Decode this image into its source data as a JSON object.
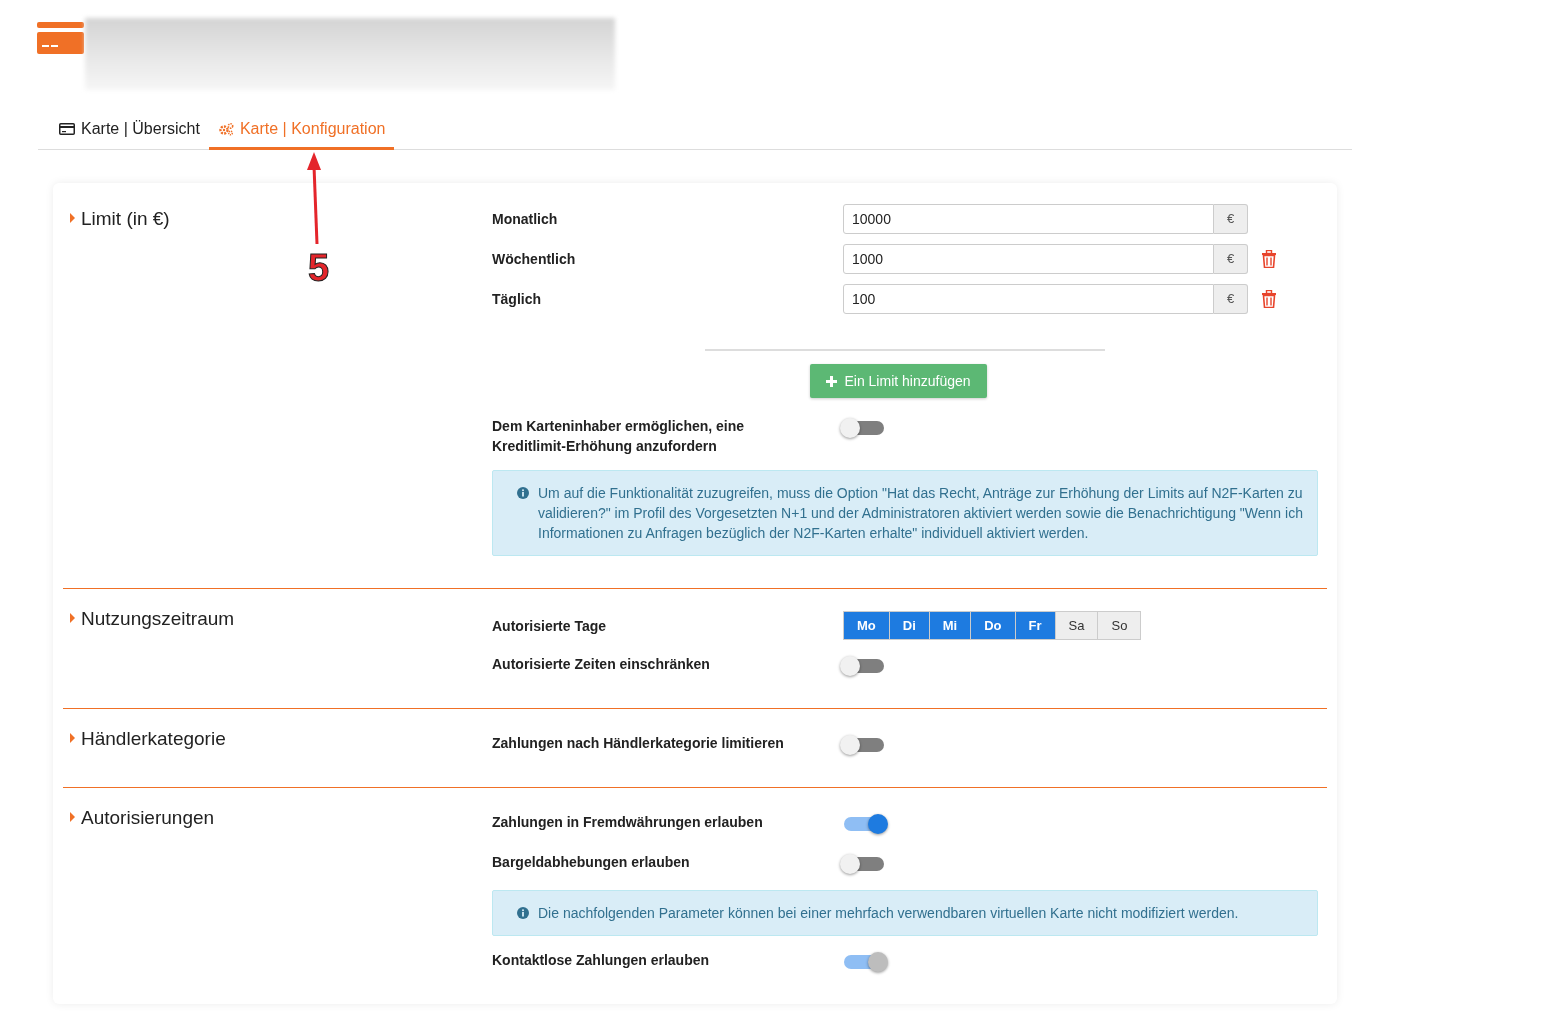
{
  "tabs": [
    {
      "label": "Karte | Übersicht",
      "selected": false
    },
    {
      "label": "Karte | Konfiguration",
      "selected": true
    }
  ],
  "annotation": {
    "label": "5"
  },
  "sections": [
    {
      "title": "Limit (in €)",
      "rows": [
        {
          "kind": "amount",
          "label": "Monatlich",
          "value": "10000",
          "unit": "€",
          "deletable": false
        },
        {
          "kind": "amount",
          "label": "Wöchentlich",
          "value": "1000",
          "unit": "€",
          "deletable": true
        },
        {
          "kind": "amount",
          "label": "Täglich",
          "value": "100",
          "unit": "€",
          "deletable": true
        },
        {
          "kind": "divider"
        },
        {
          "kind": "add_button",
          "label": "Ein Limit hinzufügen"
        },
        {
          "kind": "toggle",
          "label": "Dem Karteninhaber ermöglichen, eine Kreditlimit-Erhöhung anzufordern",
          "on": false,
          "disabled": false
        },
        {
          "kind": "info",
          "text": "Um auf die Funktionalität zuzugreifen, muss die Option \"Hat das Recht, Anträge zur Erhöhung der Limits auf N2F-Karten zu validieren?\" im Profil des Vorgesetzten N+1 und der Administratoren aktiviert werden sowie die Benachrichtigung \"Wenn ich Informationen zu Anfragen bezüglich der N2F-Karten erhalte\" individuell aktiviert werden."
        }
      ]
    },
    {
      "title": "Nutzungszeitraum",
      "rows": [
        {
          "kind": "days",
          "label": "Autorisierte Tage",
          "days": [
            {
              "label": "Mo",
              "selected": true
            },
            {
              "label": "Di",
              "selected": true
            },
            {
              "label": "Mi",
              "selected": true
            },
            {
              "label": "Do",
              "selected": true
            },
            {
              "label": "Fr",
              "selected": true
            },
            {
              "label": "Sa",
              "selected": false
            },
            {
              "label": "So",
              "selected": false
            }
          ]
        },
        {
          "kind": "toggle",
          "label": "Autorisierte Zeiten einschränken",
          "on": false,
          "disabled": false
        }
      ]
    },
    {
      "title": "Händlerkategorie",
      "rows": [
        {
          "kind": "toggle",
          "label": "Zahlungen nach Händlerkategorie limitieren",
          "on": false,
          "disabled": false
        }
      ]
    },
    {
      "title": "Autorisierungen",
      "rows": [
        {
          "kind": "toggle",
          "label": "Zahlungen in Fremdwährungen erlauben",
          "on": true,
          "disabled": false
        },
        {
          "kind": "toggle",
          "label": "Bargeldabhebungen erlauben",
          "on": false,
          "disabled": false
        },
        {
          "kind": "info",
          "text": "Die nachfolgenden Parameter können bei einer mehrfach verwendbaren virtuellen Karte nicht modifiziert werden."
        },
        {
          "kind": "toggle",
          "label": "Kontaktlose Zahlungen erlauben",
          "on": true,
          "disabled": true
        }
      ]
    }
  ]
}
